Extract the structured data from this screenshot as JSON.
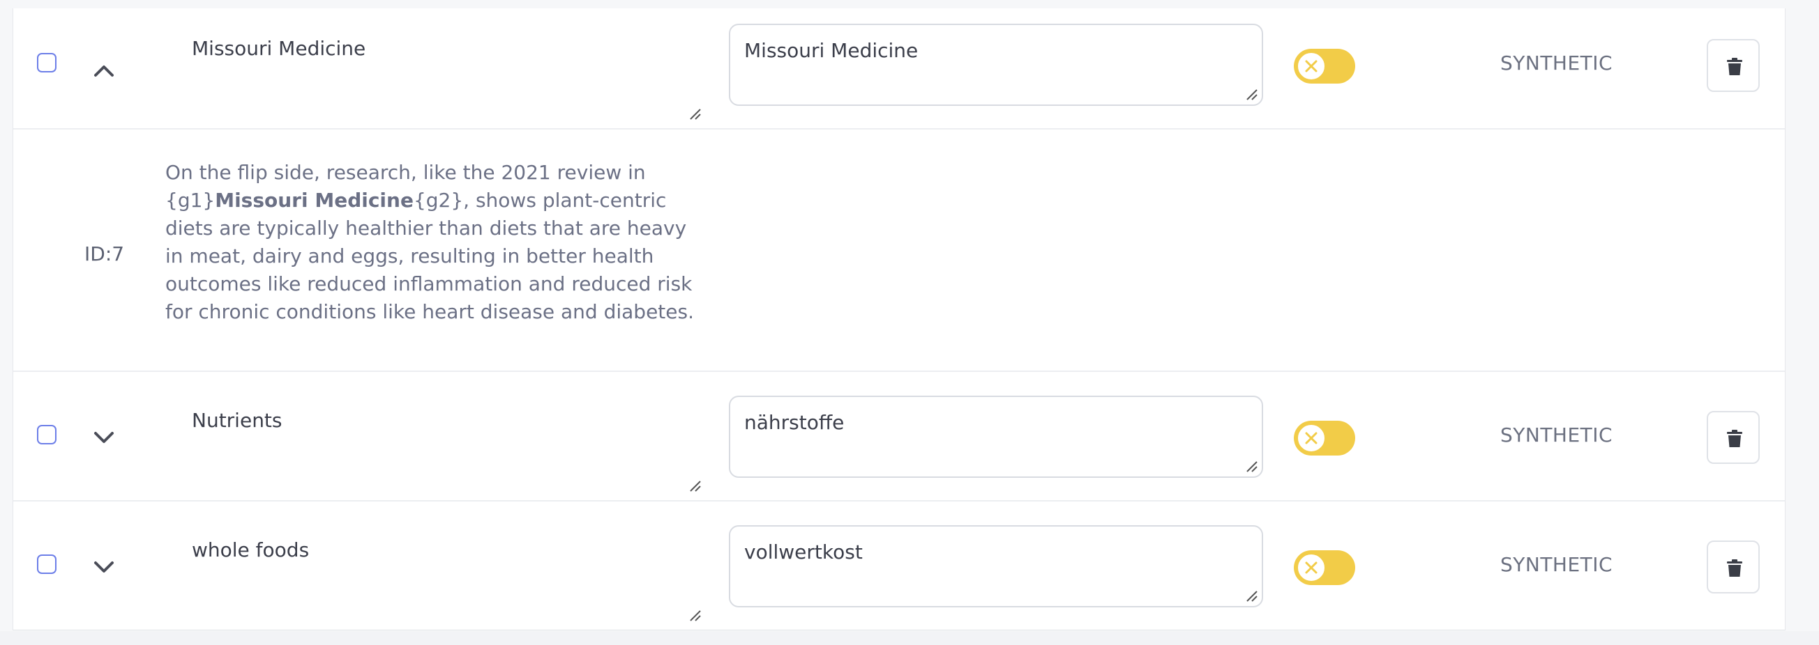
{
  "rows": [
    {
      "source": "Missouri Medicine",
      "target": "Missouri Medicine",
      "status": "SYNTHETIC",
      "expanded": true
    },
    {
      "source": "Nutrients",
      "target": "nährstoffe",
      "status": "SYNTHETIC",
      "expanded": false
    },
    {
      "source": "whole foods",
      "target": "vollwertkost",
      "status": "SYNTHETIC",
      "expanded": false
    }
  ],
  "detail": {
    "id_label": "ID:7",
    "text_before": "On the flip side, research, like the 2021 review in {g1}",
    "text_bold": "Missouri Medicine",
    "text_after": "{g2}, shows plant-centric diets are typically healthier than diets that are heavy in meat, dairy and eggs, resulting in better health outcomes like reduced inflammation and reduced risk for chronic conditions like heart disease and diabetes."
  },
  "icons": {
    "expand": "chevron-up-icon",
    "collapse": "chevron-down-icon",
    "toggle_knob": "close-icon",
    "delete": "trash-icon"
  },
  "colors": {
    "accent": "#6c7ee8",
    "toggle": "#f2cc48"
  }
}
